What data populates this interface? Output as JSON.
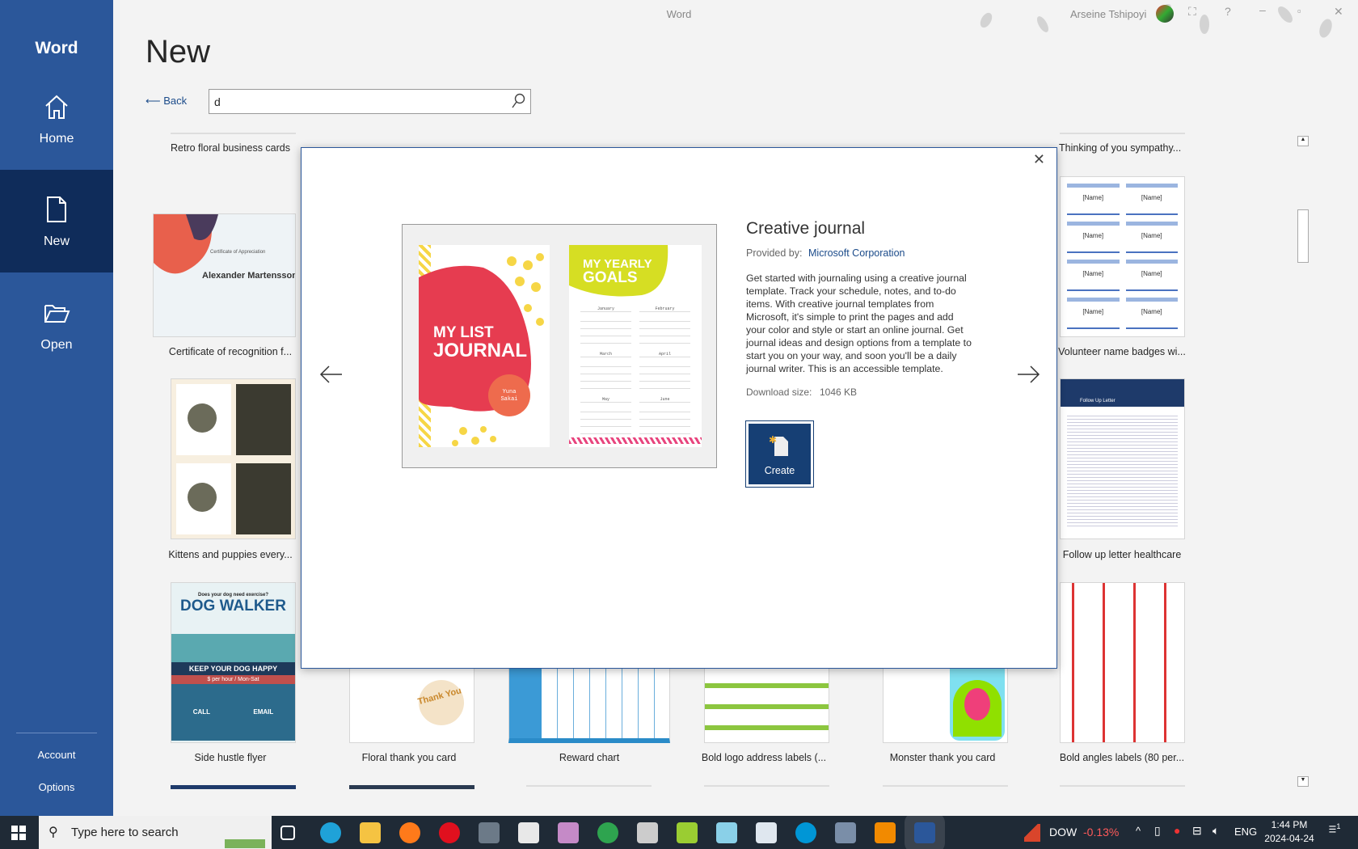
{
  "window": {
    "title": "Word",
    "user": "Arseine Tshipoyi",
    "controls": [
      "coauthor-icon",
      "help-icon",
      "minimize-icon",
      "restore-icon",
      "close-icon"
    ]
  },
  "sidebar": {
    "app": "Word",
    "items": [
      {
        "label": "Home",
        "icon": "home-icon"
      },
      {
        "label": "New",
        "icon": "new-document-icon",
        "selected": true
      },
      {
        "label": "Open",
        "icon": "folder-open-icon"
      }
    ],
    "bottom": [
      "Account",
      "Options"
    ]
  },
  "page": {
    "heading": "New",
    "back_label": "Back",
    "search_value": "d"
  },
  "templates": {
    "row1": [
      "Retro floral business cards",
      "Thinking of you sympathy..."
    ],
    "row2": [
      "Certificate of recognition f...",
      "Volunteer name badges wi..."
    ],
    "row3": [
      "Kittens and puppies every...",
      "Follow up letter healthcare"
    ],
    "row4": [
      "Side hustle flyer",
      "Floral thank you card",
      "Reward chart",
      "Bold logo address labels (...",
      "Monster thank you card",
      "Bold angles labels (80 per..."
    ],
    "thumb_text": {
      "cert_name": "Alexander Martensson",
      "cert_title": "Certificate of Appreciation",
      "badge": "[Name]",
      "dog_q": "Does your dog need exercise?",
      "dog_title": "DOG WALKER",
      "dog_sub": "KEEP YOUR DOG HAPPY",
      "dog_price": "$ per hour / Mon-Sat",
      "dog_call": "CALL",
      "dog_email": "EMAIL",
      "letter_title": "Follow Up Letter",
      "thank": "Thank You"
    }
  },
  "dialog": {
    "title": "Creative journal",
    "provided_by_label": "Provided by:",
    "provider": "Microsoft Corporation",
    "description": "Get started with journaling using a creative journal template. Track your schedule, notes, and to-do items. With creative journal templates from Microsoft, it's simple to print the pages and add your color and style or start an online journal. Get journal ideas and design options from a template to start you on your way, and soon you'll be a daily journal writer. This is an accessible template.",
    "download_label": "Download size:",
    "download_size": "1046 KB",
    "create_label": "Create",
    "preview": {
      "cover_line1": "MY LIST",
      "cover_line2": "JOURNAL",
      "author_first": "Yuna",
      "author_last": "Sakai",
      "goals_line1": "MY YEARLY",
      "goals_line2": "GOALS",
      "months": [
        "January",
        "February",
        "March",
        "April",
        "May",
        "June"
      ]
    }
  },
  "taskbar": {
    "search_placeholder": "Type here to search",
    "ticker": "DOW",
    "ticker_change": "-0.13%",
    "lang": "ENG",
    "time": "1:44 PM",
    "date": "2024-04-24",
    "notifications": "1",
    "apps": [
      "task-view",
      "edge",
      "file-explorer",
      "firefox",
      "opera",
      "calculator",
      "paint",
      "paint-3d",
      "chrome",
      "media-player",
      "notepad-plus",
      "notes",
      "3d-viewer",
      "hp",
      "network",
      "vlc",
      "word"
    ]
  },
  "colors": {
    "accent": "#2b579a",
    "dialog_button": "#163f74",
    "link": "#1b4b8a",
    "ticker_neg": "#ff5a5a"
  }
}
